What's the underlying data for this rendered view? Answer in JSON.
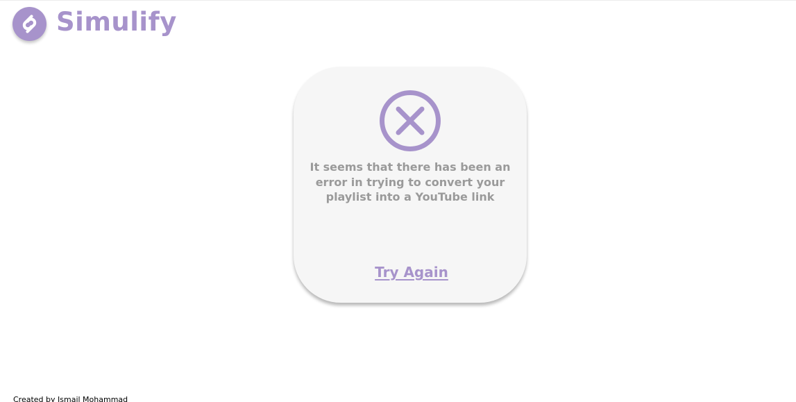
{
  "app": {
    "name": "Simulify",
    "accent_color": "#a793cb",
    "logo_icon": "shazam-style-logo-icon"
  },
  "error_card": {
    "icon": "x-circle-icon",
    "message": "It seems that there has been an error in trying to convert your playlist into a YouTube link",
    "action_label": "Try Again"
  },
  "footer": {
    "credit": "Created by Ismail Mohammad"
  }
}
